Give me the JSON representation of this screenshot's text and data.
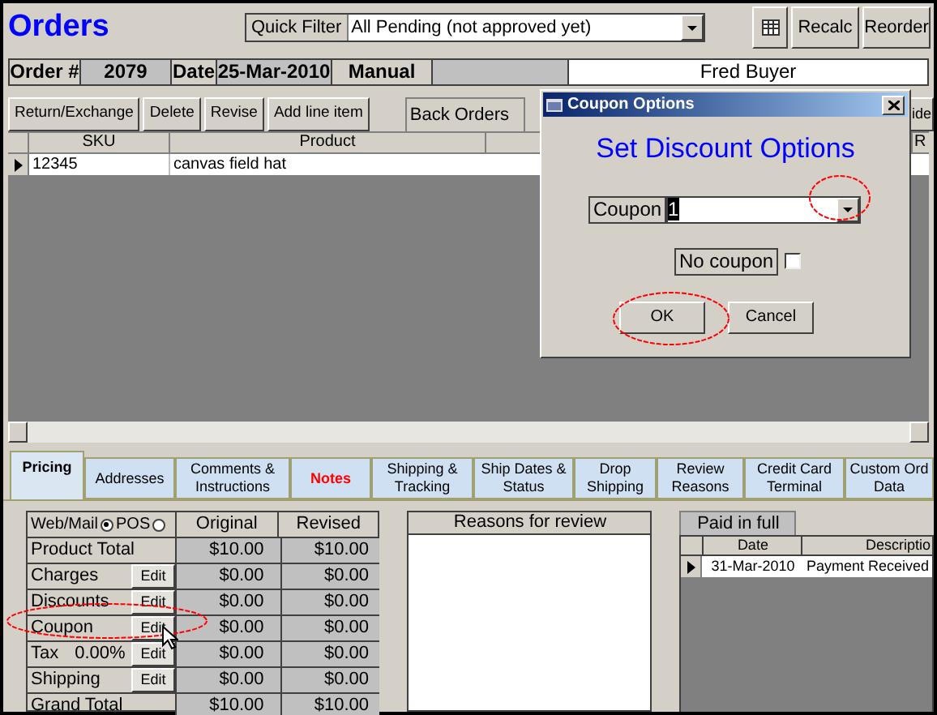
{
  "title": "Orders",
  "quick_filter": {
    "label": "Quick Filter",
    "value": "All Pending (not approved yet)"
  },
  "toolbar_buttons": [
    "Recalc",
    "Reorder"
  ],
  "order_info": {
    "order_label": "Order #",
    "order_number": "2079",
    "date_label": "Date",
    "date": "25-Mar-2010",
    "source": "Manual",
    "customer": "Fred Buyer"
  },
  "line_actions": [
    "Return/Exchange",
    "Delete",
    "Revise",
    "Add line item"
  ],
  "back_orders": {
    "label": "Back Orders"
  },
  "partial_button": "ide",
  "line_items": {
    "columns": [
      "SKU",
      "Product",
      "R"
    ],
    "rows": [
      {
        "cells": [
          "12345",
          "canvas field hat"
        ],
        "current": true
      }
    ]
  },
  "tabs": [
    {
      "label": "Pricing",
      "selected": true,
      "flagged": false
    },
    {
      "label": "Addresses",
      "selected": false,
      "flagged": false
    },
    {
      "label": "Comments &\nInstructions",
      "selected": false,
      "flagged": false
    },
    {
      "label": "Notes",
      "selected": false,
      "flagged": true
    },
    {
      "label": "Shipping &\nTracking",
      "selected": false,
      "flagged": false
    },
    {
      "label": "Ship Dates &\nStatus",
      "selected": false,
      "flagged": false
    },
    {
      "label": "Drop\nShipping",
      "selected": false,
      "flagged": false
    },
    {
      "label": "Review\nReasons",
      "selected": false,
      "flagged": false
    },
    {
      "label": "Credit Card\nTerminal",
      "selected": false,
      "flagged": false
    },
    {
      "label": "Custom Ord\nData",
      "selected": false,
      "flagged": false
    }
  ],
  "pricing": {
    "order_type": [
      {
        "label": "Web/Mail",
        "selected": true
      },
      {
        "label": "POS",
        "selected": false
      }
    ],
    "columns": [
      "Original",
      "Revised"
    ],
    "rows": [
      {
        "label": "Product Total",
        "original": "$10.00",
        "revised": "$10.00"
      },
      {
        "label": "Charges",
        "edit": "Edit",
        "original": "$0.00",
        "revised": "$0.00"
      },
      {
        "label": "Discounts",
        "edit": "Edit",
        "original": "$0.00",
        "revised": "$0.00"
      },
      {
        "label": "Coupon",
        "edit": "Edit",
        "original": "$0.00",
        "revised": "$0.00"
      },
      {
        "label": "Tax",
        "rate": "0.00%",
        "edit": "Edit",
        "original": "$0.00",
        "revised": "$0.00"
      },
      {
        "label": "Shipping",
        "edit": "Edit",
        "original": "$0.00",
        "revised": "$0.00"
      },
      {
        "label": "Grand Total",
        "original": "$10.00",
        "revised": "$10.00"
      }
    ]
  },
  "reasons": {
    "title": "Reasons for review"
  },
  "payments": {
    "tab": "Paid in full",
    "columns": [
      "Date",
      "Descriptio"
    ],
    "rows": [
      {
        "cells": [
          "31-Mar-2010",
          "Payment Received"
        ],
        "current": true
      }
    ]
  },
  "dialog": {
    "title": "Coupon Options",
    "heading": "Set Discount Options",
    "coupon": {
      "label": "Coupon",
      "value": "1"
    },
    "no_coupon": {
      "label": "No coupon",
      "checked": false
    },
    "buttons": [
      "OK",
      "Cancel"
    ]
  }
}
